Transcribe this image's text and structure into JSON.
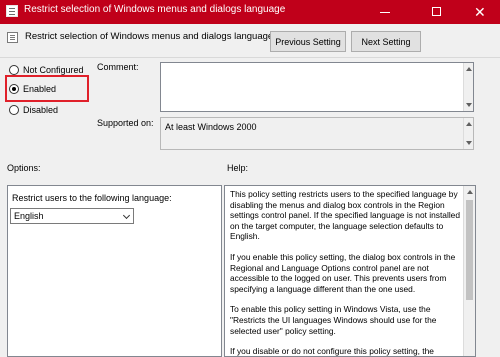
{
  "window": {
    "title": "Restrict selection of Windows menus and dialogs language",
    "accent": "#c0001a"
  },
  "header": {
    "policy_name": "Restrict selection of Windows menus and dialogs language",
    "prev_label": "Previous Setting",
    "next_label": "Next Setting"
  },
  "state": {
    "options": [
      {
        "label": "Not Configured",
        "checked": false
      },
      {
        "label": "Enabled",
        "checked": true
      },
      {
        "label": "Disabled",
        "checked": false
      }
    ],
    "highlight_color": "#e0202a"
  },
  "comment": {
    "label": "Comment:",
    "value": ""
  },
  "supported": {
    "label": "Supported on:",
    "value": "At least Windows 2000"
  },
  "options_section": {
    "label": "Options:",
    "caption": "Restrict users to the following language:",
    "selected_language": "English"
  },
  "help_section": {
    "label": "Help:",
    "paragraphs": [
      "This policy setting restricts users to the specified language by disabling the menus and dialog box controls in the Region settings control panel. If the specified language is not installed on the target computer, the language selection defaults to English.",
      "If you enable this policy setting, the dialog box controls in the Regional and Language Options control panel are not accessible to the logged on user. This prevents users from specifying a language different than the one used.",
      "To enable this policy setting in Windows Vista, use the \"Restricts the UI languages Windows should use for the selected user\" policy setting.",
      "If you disable or do not configure this policy setting, the"
    ]
  },
  "icons": {
    "app": "policy-icon",
    "minimize": "minimize-icon",
    "maximize": "maximize-icon",
    "close": "close-icon",
    "dropdown": "chevron-down-icon"
  }
}
